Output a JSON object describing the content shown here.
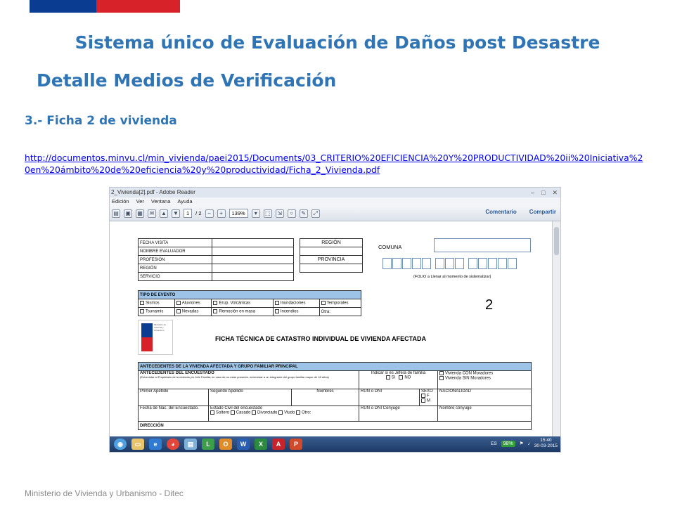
{
  "slide": {
    "title": "Sistema único de  Evaluación de Daños post Desastre",
    "subtitle": "Detalle  Medios de Verificación",
    "section": "3.- Ficha 2 de vivienda",
    "link": "http://documentos.minvu.cl/min_vivienda/paei2015/Documents/03_CRITERIO%20EFICIENCIA%20Y%20PRODUCTIVIDAD%20ii%20Iniciativa%20en%20ámbito%20de%20eficiencia%20y%20productividad/Ficha_2_Vivienda.pdf",
    "footer": "Ministerio de Vivienda y Urbanismo - Ditec",
    "colors": {
      "title": "#2f74b5",
      "flag_blue": "#0a3d91",
      "flag_red": "#d7222a"
    }
  },
  "reader": {
    "window_title": "2_Vivienda[2].pdf - Adobe Reader",
    "menu": [
      "Edición",
      "Ver",
      "Ventana",
      "Ayuda"
    ],
    "page_current": "1",
    "page_total": "/ 2",
    "zoom": "139%",
    "comment_label": "Comentario",
    "share_label": "Compartir"
  },
  "form": {
    "fecha_visita": "FECHA VISITA",
    "nombre_evaluador": "NOMBRE EVALUADOR",
    "profesion": "PROFESIÓN",
    "region": "REGIÓN",
    "servicio": "SERVICIO",
    "region_header": "REGIÓN",
    "provincia_header": "PROVINCIA",
    "comuna": "COMUNA",
    "folio_note": "(FOLIO a Llenar al momento de sistematizar)",
    "tipo_evento": "TIPO DE EVENTO",
    "eventos_row1": [
      "Sismos",
      "Aluviones",
      "Erup. Volcánicas",
      "Inundaciones",
      "Temporales"
    ],
    "eventos_row2": [
      "Tsunamis",
      "Nevadas",
      "Remoción en masa",
      "Incendios",
      "Otra:"
    ],
    "number": "2",
    "ficha_title": "FICHA TÉCNICA DE CATASTRO INDIVIDUAL DE VIVIENDA AFECTADA",
    "antecedentes": "ANTECEDENTES DE LA VIVIENDA AFECTADA Y GRUPO FAMILIAR PRINCIPAL",
    "encuestado": "ANTECEDENTES DEL ENCUESTADO",
    "encuestado_note": "(Entrevistar al Propietario de la vivienda y/o Jefe Familia; en caso de no estar presente, entrevistar a un integrante del grupo familiar mayor de 18 años)",
    "jefa_familia": "Indicar si es Jefe/a de familia",
    "si": "SI",
    "no": "NO",
    "con_moradores": "Vivienda CON Moradores",
    "sin_moradores": "Vivienda SIN Moradores",
    "primer_apellido": "Primer Apellido",
    "segundo_apellido": "Segundo Apellido",
    "nombres": "Nombres",
    "run_dni": "RUN o DNI",
    "sexo": "SEXO",
    "f": "F",
    "m": "M",
    "nacionalidad": "NACIONALIDAD",
    "fecha_nac": "Fecha de Nac. del Encuestado.",
    "estado_civil": "Estado Civil del encuestado",
    "run_conyuge": "RUN o DNI Cónyuge",
    "nombre_conyuge": "Nombre cónyuge",
    "civil_options": [
      "Soltero",
      "Casado",
      "Divorciado",
      "Viudo",
      "Otro:"
    ],
    "direccion": "DIRECCIÓN"
  },
  "taskbar": {
    "lang": "ES",
    "battery": "98%",
    "time": "15:40",
    "date": "30-03-2015"
  }
}
